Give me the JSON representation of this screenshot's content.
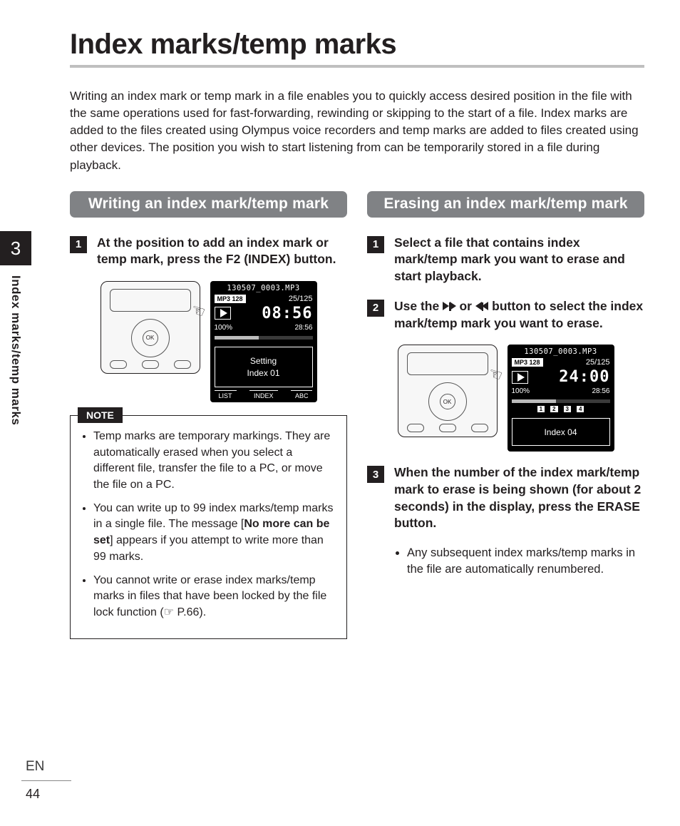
{
  "page": {
    "title": "Index marks/temp marks",
    "intro": "Writing an index mark or temp mark in a file enables you to quickly access desired position in the file with the same operations used for fast-forwarding, rewinding or skipping to the start of a file. Index marks are added to the files created using Olympus voice recorders and temp marks are added to files created using other devices. The position you wish to start listening from can be temporarily stored in a file during playback.",
    "chapter_number": "3",
    "side_label": "Index marks/temp marks",
    "language": "EN",
    "number": "44"
  },
  "left": {
    "heading": "Writing an index mark/temp mark",
    "step1_pre": "At the position to add an index mark or temp mark, press the ",
    "step1_bold": "F2 (INDEX)",
    "step1_post": " button.",
    "screen": {
      "file": "130507_0003.MP3",
      "badge": "MP3 128",
      "counter": "25/125",
      "time_big": "08:56",
      "vol": "100%",
      "duration": "28:56",
      "box_line1": "Setting",
      "box_line2": "Index 01",
      "soft_left": "LIST",
      "soft_mid": "INDEX",
      "soft_right": "ABC"
    },
    "note_label": "NOTE",
    "notes": {
      "n1": "Temp marks are temporary markings. They are automatically erased when you select a different file, transfer the file to a PC, or move the file on a PC.",
      "n2_pre": "You can write up to 99 index marks/temp marks in a single file. The message [",
      "n2_bold": "No more can be set",
      "n2_post": "] appears if you attempt to write more than 99 marks.",
      "n3_pre": "You cannot write or erase index marks/temp marks in files that have been locked by the file lock function (",
      "n3_post": " P.66)."
    }
  },
  "right": {
    "heading": "Erasing an index mark/temp mark",
    "step1": "Select a file that contains index mark/temp mark you want to erase and start playback.",
    "step2_pre": "Use the ",
    "step2_mid": " or ",
    "step2_post": " button to select the index mark/temp mark you want to erase.",
    "screen": {
      "file": "130507_0003.MP3",
      "badge": "MP3 128",
      "counter": "25/125",
      "time_big": "24:00",
      "vol": "100%",
      "duration": "28:56",
      "marks": [
        "1",
        "2",
        "3",
        "4"
      ],
      "box_line1": "Index 04"
    },
    "step3_pre": "When the number of the index mark/temp mark to erase is being shown (for about 2 seconds) in the display, press the ",
    "step3_bold": "ERASE",
    "step3_post": " button.",
    "sub_bullet": "Any subsequent index marks/temp marks in the file are automatically renumbered."
  }
}
